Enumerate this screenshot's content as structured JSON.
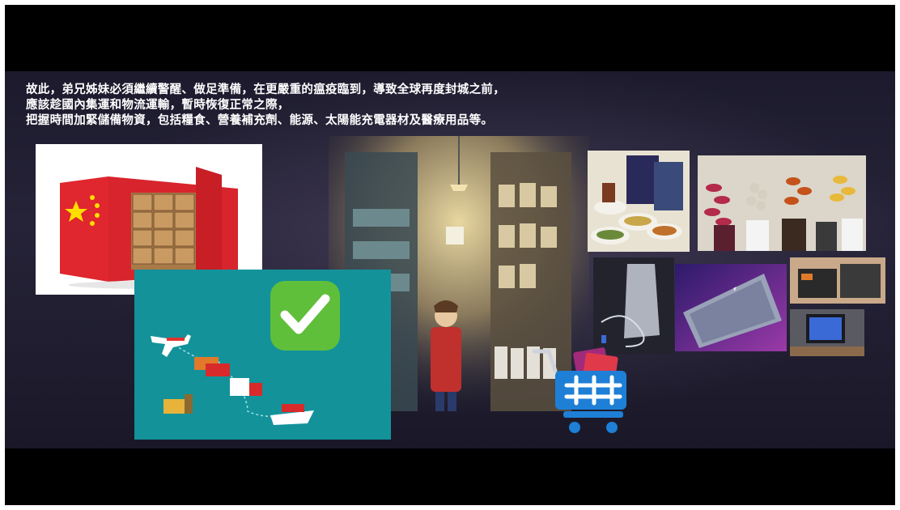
{
  "caption": {
    "line1": "故此，弟兄姊妹必須繼續警醒、做足準備，在更嚴重的瘟疫臨到，導致全球再度封城之前，",
    "line2": "應該趁國內集運和物流運輸，暫時恢復正常之際，",
    "line3": "把握時間加緊儲備物資，包括糧食、營養補充劑、能源、太陽能充電器材及醫療用品等。"
  },
  "colors": {
    "slide_bg": "#201d30",
    "logistics_bg": "#13929a",
    "check_green": "#5fbf3a",
    "cart_blue": "#1e7fd6"
  }
}
